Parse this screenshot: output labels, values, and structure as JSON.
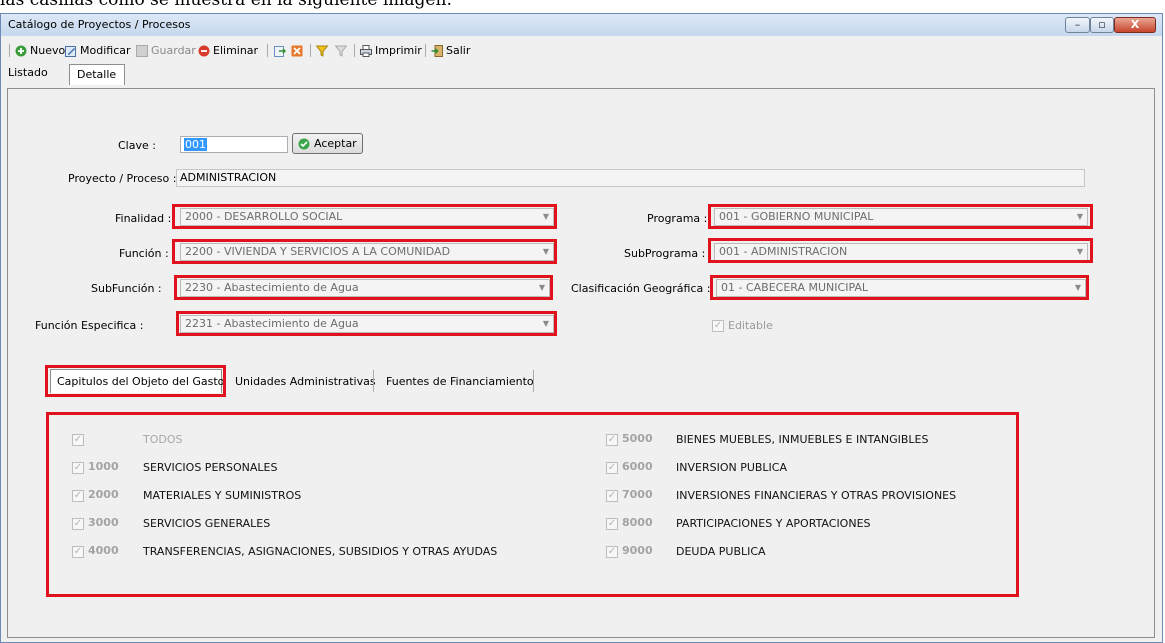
{
  "above_text": "las casillas como se muestra en la siguiente imagen:",
  "window": {
    "title": "Catálogo de Proyectos / Procesos",
    "min": "–",
    "max": "▫",
    "close": "X"
  },
  "toolbar": {
    "nuevo": "Nuevo",
    "modificar": "Modificar",
    "guardar": "Guardar",
    "eliminar": "Eliminar",
    "imprimir": "Imprimir",
    "salir": "Salir"
  },
  "tabs": {
    "listado": "Listado",
    "detalle": "Detalle"
  },
  "form": {
    "clave_label": "Clave :",
    "clave_value": "001",
    "aceptar": "Aceptar",
    "proyecto_label": "Proyecto / Proceso :",
    "proyecto_value": "ADMINISTRACION",
    "finalidad_label": "Finalidad :",
    "finalidad_value": "2000 - DESARROLLO SOCIAL",
    "funcion_label": "Función :",
    "funcion_value": "2200 - VIVIENDA Y SERVICIOS  A LA COMUNIDAD",
    "subfuncion_label": "SubFunción :",
    "subfuncion_value": "2230 - Abastecimiento de Agua",
    "funcion_esp_label": "Función Especifica :",
    "funcion_esp_value": "2231 - Abastecimiento de Agua",
    "programa_label": "Programa :",
    "programa_value": "001 - GOBIERNO MUNICIPAL",
    "subprograma_label": "SubPrograma :",
    "subprograma_value": "001 - ADMINISTRACION",
    "clasif_label": "Clasificación Geográfica :",
    "clasif_value": "01 - CABECERA MUNICIPAL",
    "editable_label": "Editable"
  },
  "subtabs": {
    "capitulos": "Capitulos del Objeto del Gasto",
    "unidades": "Unidades Administrativas",
    "fuentes": "Fuentes de Financiamiento"
  },
  "capitulos": {
    "todos": "TODOS",
    "left": [
      {
        "code": "1000",
        "desc": "SERVICIOS PERSONALES"
      },
      {
        "code": "2000",
        "desc": "MATERIALES Y SUMINISTROS"
      },
      {
        "code": "3000",
        "desc": "SERVICIOS GENERALES"
      },
      {
        "code": "4000",
        "desc": "TRANSFERENCIAS, ASIGNACIONES, SUBSIDIOS Y OTRAS AYUDAS"
      }
    ],
    "right": [
      {
        "code": "5000",
        "desc": "BIENES MUEBLES, INMUEBLES E INTANGIBLES"
      },
      {
        "code": "6000",
        "desc": "INVERSION PUBLICA"
      },
      {
        "code": "7000",
        "desc": "INVERSIONES FINANCIERAS Y OTRAS PROVISIONES"
      },
      {
        "code": "8000",
        "desc": "PARTICIPACIONES Y APORTACIONES"
      },
      {
        "code": "9000",
        "desc": "DEUDA PUBLICA"
      }
    ]
  },
  "colors": {
    "highlight": "#e0121b",
    "title_bar": "#c5d8ee"
  }
}
